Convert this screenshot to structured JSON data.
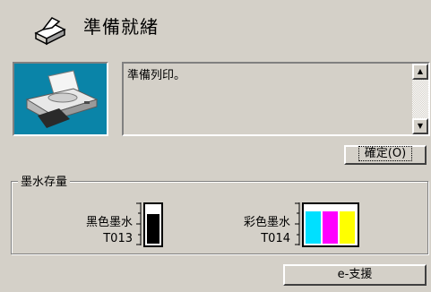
{
  "status": {
    "title": "準備就緒",
    "icon": "printer-status-icon"
  },
  "message": {
    "text": "準備列印。",
    "scroll_up": "▲",
    "scroll_down": "▼"
  },
  "buttons": {
    "ok_label": "確定(O)",
    "esupport_label": "e-支援"
  },
  "ink": {
    "group_label": "墨水存量",
    "black": {
      "name": "黑色墨水",
      "model": "T013",
      "level": 0.78,
      "color": "#000000"
    },
    "color": {
      "name": "彩色墨水",
      "model": "T014",
      "levels": [
        {
          "color_name": "cyan",
          "color": "#00e0ff",
          "level": 0.85
        },
        {
          "color_name": "magenta",
          "color": "#ff00ff",
          "level": 0.85
        },
        {
          "color_name": "yellow",
          "color": "#ffff00",
          "level": 0.85
        }
      ]
    }
  },
  "colors": {
    "dialog_bg": "#d4d0c8",
    "printer_bg": "#0a84a8"
  }
}
